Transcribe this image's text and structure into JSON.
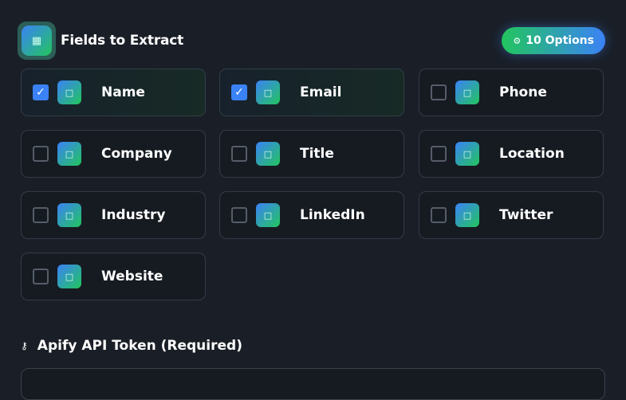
{
  "header": {
    "title": "Fields to Extract",
    "icon": "table-icon",
    "options_icon": "sliders-icon",
    "options_label": "10 Options"
  },
  "fields": [
    {
      "label": "Name",
      "checked": true,
      "icon": "user-icon"
    },
    {
      "label": "Email",
      "checked": true,
      "icon": "mail-icon"
    },
    {
      "label": "Phone",
      "checked": false,
      "icon": "phone-icon"
    },
    {
      "label": "Company",
      "checked": false,
      "icon": "building-icon"
    },
    {
      "label": "Title",
      "checked": false,
      "icon": "briefcase-icon"
    },
    {
      "label": "Location",
      "checked": false,
      "icon": "map-pin-icon"
    },
    {
      "label": "Industry",
      "checked": false,
      "icon": "factory-icon"
    },
    {
      "label": "LinkedIn",
      "checked": false,
      "icon": "linkedin-icon"
    },
    {
      "label": "Twitter",
      "checked": false,
      "icon": "twitter-icon"
    },
    {
      "label": "Website",
      "checked": false,
      "icon": "globe-icon"
    }
  ],
  "token": {
    "label": "Apify API Token (Required)",
    "icon": "key-icon",
    "value": ""
  },
  "colors": {
    "accent_blue": "#3b82f6",
    "accent_green": "#22c55e",
    "background": "#1a1f27"
  }
}
